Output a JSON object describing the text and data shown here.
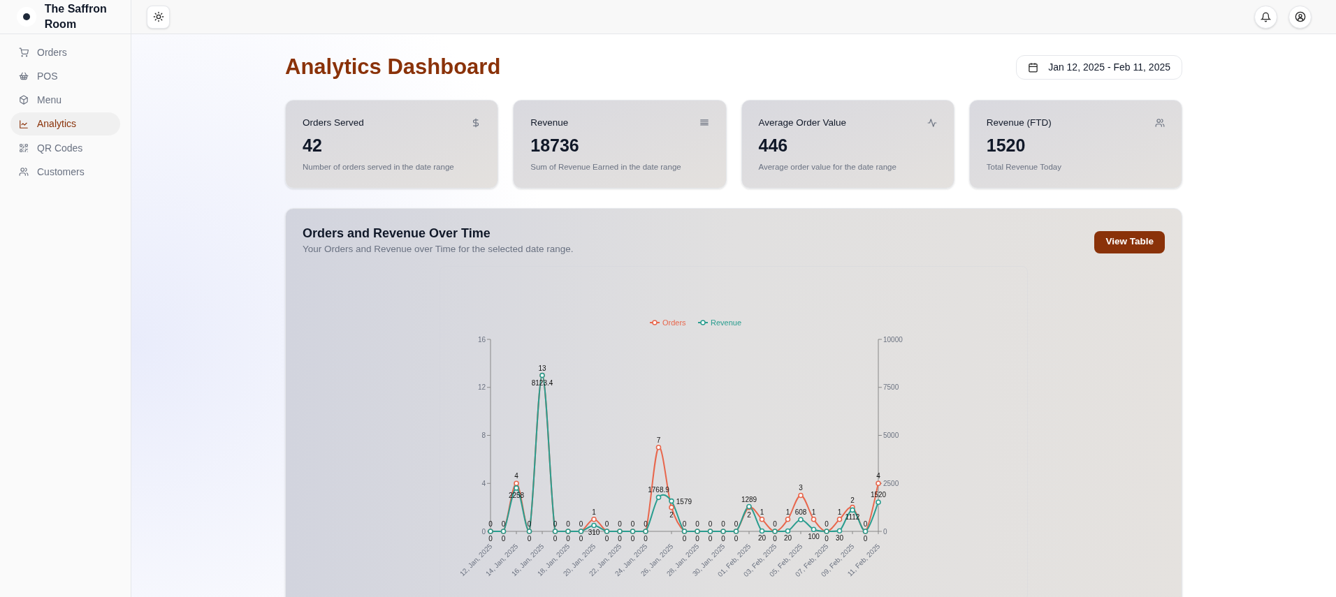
{
  "brand": {
    "name": "The Saffron Room"
  },
  "sidebar": {
    "items": [
      {
        "label": "Orders",
        "selected": false
      },
      {
        "label": "POS",
        "selected": false
      },
      {
        "label": "Menu",
        "selected": false
      },
      {
        "label": "Analytics",
        "selected": true
      },
      {
        "label": "QR Codes",
        "selected": false
      },
      {
        "label": "Customers",
        "selected": false
      }
    ]
  },
  "page": {
    "title": "Analytics Dashboard",
    "date_range": "Jan 12, 2025 - Feb 11, 2025"
  },
  "cards": [
    {
      "title": "Orders Served",
      "value": "42",
      "description": "Number of orders served in the date range"
    },
    {
      "title": "Revenue",
      "value": "18736",
      "description": "Sum of Revenue Earned in the date range"
    },
    {
      "title": "Average Order Value",
      "value": "446",
      "description": "Average order value for the date range"
    },
    {
      "title": "Revenue (FTD)",
      "value": "1520",
      "description": "Total Revenue Today"
    }
  ],
  "chart_panel": {
    "title": "Orders and Revenue Over Time",
    "subtitle": "Your Orders and Revenue over Time for the selected date range.",
    "button": "View Table",
    "chart_data": {
      "type": "line",
      "data_labels": true,
      "legend": "top",
      "categories": [
        "12, Jan, 2025",
        null,
        "14, Jan, 2025",
        null,
        "16, Jan, 2025",
        null,
        "18, Jan, 2025",
        null,
        "20, Jan, 2025",
        null,
        "22, Jan, 2025",
        null,
        "24, Jan, 2025",
        null,
        "26, Jan, 2025",
        null,
        "28, Jan, 2025",
        null,
        "30, Jan, 2025",
        null,
        "01, Feb, 2025",
        null,
        "03, Feb, 2025",
        null,
        "05, Feb, 2025",
        null,
        "07, Feb, 2025",
        null,
        "09, Feb, 2025",
        null,
        "11, Feb, 2025"
      ],
      "ylim": [
        0,
        16
      ],
      "yticks": [
        0,
        4,
        8,
        12,
        16
      ],
      "y2lim": [
        0,
        10000
      ],
      "y2ticks": [
        0,
        2500,
        5000,
        7500,
        10000
      ],
      "series": [
        {
          "name": "Orders",
          "color": "#e8674d",
          "marker": "circle",
          "values": [
            0,
            0,
            4,
            0,
            13,
            0,
            0,
            0,
            1,
            0,
            0,
            0,
            0,
            7,
            2,
            0,
            0,
            0,
            0,
            0,
            2,
            1,
            0,
            1,
            3,
            1,
            0,
            1,
            2,
            0,
            4
          ]
        },
        {
          "name": "Revenue",
          "color": "#2a9d8f",
          "axis": "y2",
          "marker": "circle",
          "values": [
            0,
            0,
            2258,
            0,
            8123.4,
            0,
            0,
            0,
            310,
            0,
            0,
            0,
            0,
            1768.9,
            1579,
            0,
            0,
            0,
            0,
            0,
            1289,
            20,
            0,
            20,
            608,
            100,
            0,
            30,
            1112,
            0,
            1520
          ]
        }
      ]
    }
  }
}
